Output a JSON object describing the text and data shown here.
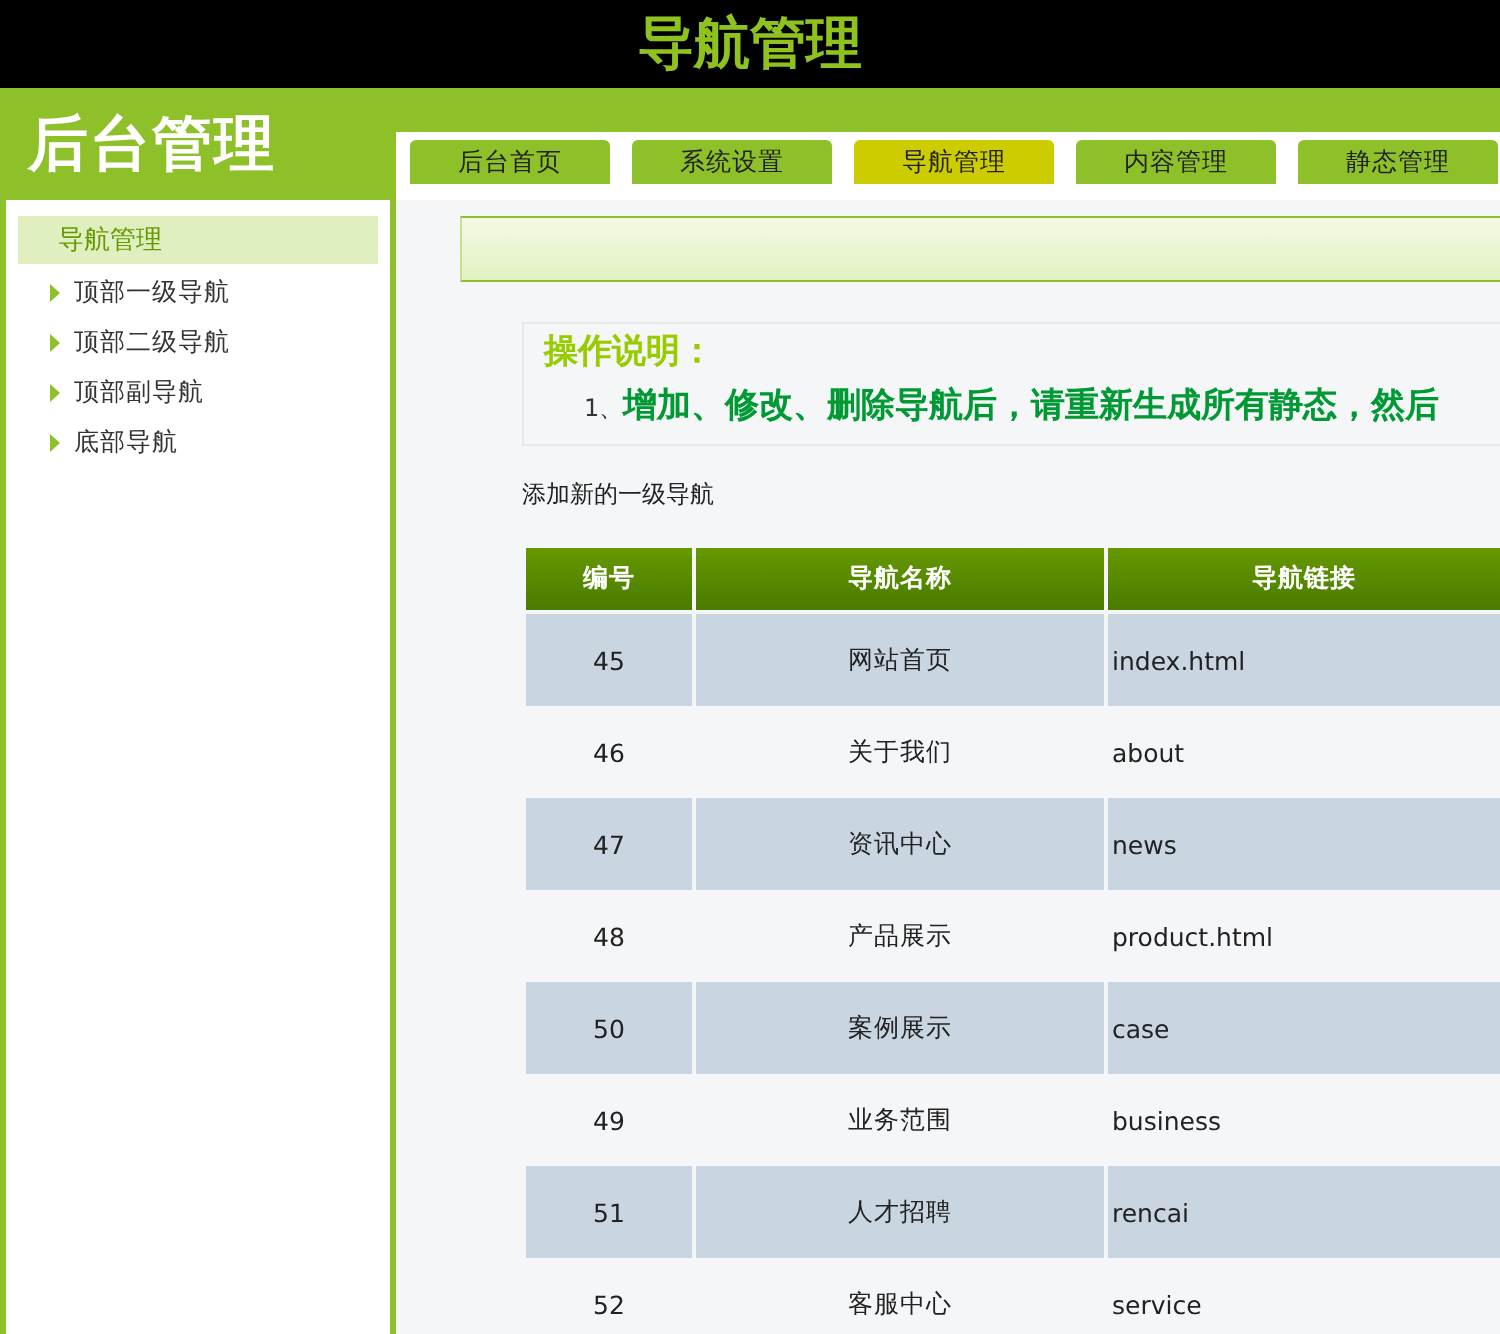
{
  "header": {
    "title": "导航管理"
  },
  "logo": {
    "text": "后台管理"
  },
  "tabs": [
    {
      "label": "后台首页",
      "selected": false
    },
    {
      "label": "系统设置",
      "selected": false
    },
    {
      "label": "导航管理",
      "selected": true
    },
    {
      "label": "内容管理",
      "selected": false
    },
    {
      "label": "静态管理",
      "selected": false
    }
  ],
  "sidebar": {
    "heading": "导航管理",
    "items": [
      {
        "label": "顶部一级导航"
      },
      {
        "label": "顶部二级导航"
      },
      {
        "label": "顶部副导航"
      },
      {
        "label": "底部导航"
      }
    ]
  },
  "instructions": {
    "title": "操作说明：",
    "items": [
      {
        "number": "1、",
        "text": "增加、修改、删除导航后，请重新生成所有静态，然后"
      }
    ]
  },
  "add_link": "添加新的一级导航",
  "table": {
    "columns": [
      "编号",
      "导航名称",
      "导航链接"
    ],
    "rows": [
      [
        "45",
        "网站首页",
        "index.html"
      ],
      [
        "46",
        "关于我们",
        "about"
      ],
      [
        "47",
        "资讯中心",
        "news"
      ],
      [
        "48",
        "产品展示",
        "product.html"
      ],
      [
        "50",
        "案例展示",
        "case"
      ],
      [
        "49",
        "业务范围",
        "business"
      ],
      [
        "51",
        "人才招聘",
        "rencai"
      ],
      [
        "52",
        "客服中心",
        "service"
      ]
    ]
  }
}
